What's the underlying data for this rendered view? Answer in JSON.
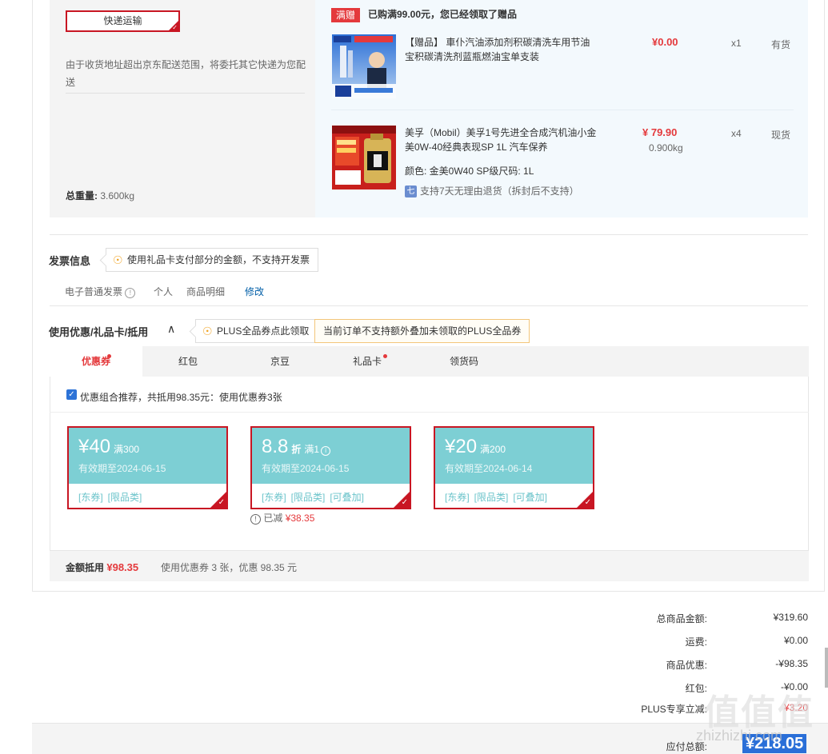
{
  "shipping": {
    "method_label": "快递运输",
    "note": "由于收货地址超出京东配送范围，将委托其它快递为您配送",
    "weight_label": "总重量:",
    "weight_value": "3.600kg"
  },
  "gift_banner": {
    "tag": "满赠",
    "message": "已购满99.00元，您已经领取了赠品"
  },
  "items": [
    {
      "title": "【赠品】 車仆汽油添加剂积碳清洗车用节油宝积碳清洗剂蓝瓶燃油宝单支装",
      "price": "¥0.00",
      "qty": "x1",
      "stock": "有货",
      "image_caption": "节油 提动力"
    },
    {
      "title": "美孚（Mobil）美孚1号先进全合成汽机油小金美0W-40经典表现SP 1L 汽车保养",
      "price": "¥ 79.90",
      "weight": "0.900kg",
      "qty": "x4",
      "stock": "现货",
      "attrs": "颜色: 金美0W40 SP级尺码: 1L",
      "return_icon": "七",
      "return_policy": "支持7天无理由退货（拆封后不支持）"
    }
  ],
  "invoice": {
    "title": "发票信息",
    "tip": "使用礼品卡支付部分的金额，不支持开发票",
    "type": "电子普通发票",
    "recipient": "个人",
    "content": "商品明细",
    "modify": "修改"
  },
  "discount": {
    "title": "使用优惠/礼品卡/抵用",
    "plus_tip": "PLUS全品券点此领取",
    "plus_notice": "当前订单不支持额外叠加未领取的PLUS全品券",
    "tabs": [
      "优惠券",
      "红包",
      "京豆",
      "礼品卡",
      "领货码"
    ],
    "combo_text": "优惠组合推荐，共抵用98.35元：使用优惠券3张",
    "coupons": [
      {
        "amount": "¥40",
        "condition": "满300",
        "valid": "有效期至2024-06-15",
        "tags": [
          "[东券]",
          "[限品类]"
        ]
      },
      {
        "amount": "8.8",
        "unit": "折",
        "condition": "满1",
        "valid": "有效期至2024-06-15",
        "tags": [
          "[东券]",
          "[限品类]",
          "[可叠加]"
        ]
      },
      {
        "amount": "¥20",
        "condition": "满200",
        "valid": "有效期至2024-06-14",
        "tags": [
          "[东券]",
          "[限品类]",
          "[可叠加]"
        ]
      }
    ],
    "reduced_label": "已减",
    "reduced_value": "¥38.35",
    "sum_label": "金额抵用",
    "sum_value": "¥98.35",
    "sum_desc": "使用优惠券 3 张，优惠 98.35 元"
  },
  "totals": {
    "goods_label": "总商品金额:",
    "goods_value": "¥319.60",
    "freight_label": "运费:",
    "freight_value": "¥0.00",
    "discount_label": "商品优惠:",
    "discount_value": "-¥98.35",
    "redpack_label": "红包:",
    "redpack_value": "-¥0.00",
    "plus_label": "PLUS专享立减:",
    "plus_value": "¥3.20",
    "payable_label": "应付总额:",
    "payable_value": "¥218.05"
  },
  "watermark": {
    "logo": "值值值",
    "url": "zhizhizhi.com"
  }
}
